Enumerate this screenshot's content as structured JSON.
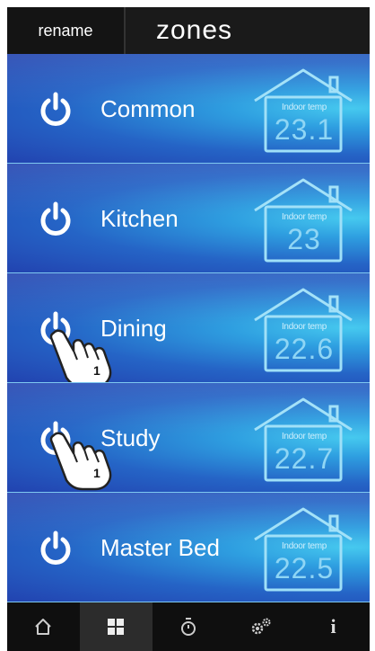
{
  "header": {
    "rename_label": "rename",
    "title": "zones"
  },
  "zones": [
    {
      "label": "Common",
      "temp_caption": "Indoor temp",
      "temp_value": "23.1"
    },
    {
      "label": "Kitchen",
      "temp_caption": "Indoor temp",
      "temp_value": "23"
    },
    {
      "label": "Dining",
      "temp_caption": "Indoor temp",
      "temp_value": "22.6"
    },
    {
      "label": "Study",
      "temp_caption": "Indoor temp",
      "temp_value": "22.7"
    },
    {
      "label": "Master Bed",
      "temp_caption": "Indoor temp",
      "temp_value": "22.5"
    }
  ],
  "tap_markers": [
    {
      "zone": "Dining",
      "step": "1"
    },
    {
      "zone": "Study",
      "step": "1"
    }
  ],
  "tabbar": {
    "tabs": [
      {
        "icon": "home-icon",
        "active": false
      },
      {
        "icon": "zones-grid-icon",
        "active": true
      },
      {
        "icon": "timer-icon",
        "active": false
      },
      {
        "icon": "settings-gears-icon",
        "active": false
      },
      {
        "icon": "info-icon",
        "active": false,
        "glyph": "i"
      }
    ]
  },
  "colors": {
    "header_bg": "#1a1a1a",
    "row_dark": "#2243b0",
    "row_light": "#46c9ef",
    "tabbar_bg": "#0f0f0f",
    "temp_text": "#8fd6f5"
  }
}
